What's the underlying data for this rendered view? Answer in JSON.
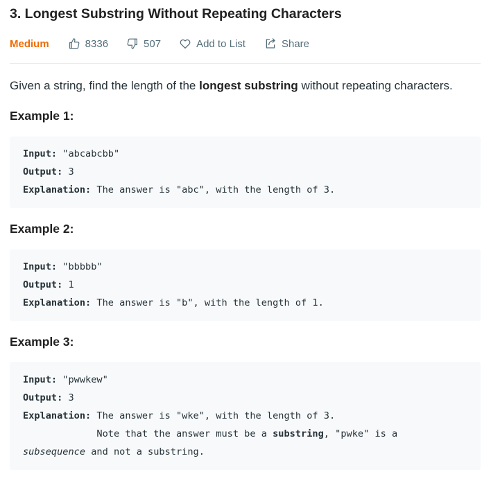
{
  "problem": {
    "title": "3. Longest Substring Without Repeating Characters",
    "difficulty": "Medium",
    "likes": "8336",
    "dislikes": "507",
    "add_to_list": "Add to List",
    "share": "Share"
  },
  "description": {
    "before": "Given a string, find the length of the ",
    "bold": "longest substring",
    "after": " without repeating characters."
  },
  "examples": [
    {
      "title": "Example 1:",
      "input_label": "Input:",
      "input_value": " \"abcabcbb\"",
      "output_label": "Output:",
      "output_value": " 3",
      "explanation_label": "Explanation:",
      "explanation_value": " The answer is \"abc\", with the length of 3."
    },
    {
      "title": "Example 2:",
      "input_label": "Input:",
      "input_value": " \"bbbbb\"",
      "output_label": "Output:",
      "output_value": " 1",
      "explanation_label": "Explanation:",
      "explanation_value": " The answer is \"b\", with the length of 1."
    },
    {
      "title": "Example 3:",
      "input_label": "Input:",
      "input_value": " \"pwwkew\"",
      "output_label": "Output:",
      "output_value": " 3",
      "explanation_label": "Explanation:",
      "explanation_value": " The answer is \"wke\", with the length of 3.",
      "note_prefix": "             Note that the answer must be a ",
      "note_bold": "substring",
      "note_mid": ", \"pwke\" is a",
      "note_italic": "subsequence",
      "note_suffix": " and not a substring."
    }
  ],
  "icons": {
    "like": "thumbs-up-icon",
    "dislike": "thumbs-down-icon",
    "add_to_list": "heart-icon",
    "share": "share-icon"
  },
  "colors": {
    "difficulty_medium": "#ef6c00",
    "code_background": "#f7f9fa",
    "meta_text": "#546e7a"
  }
}
